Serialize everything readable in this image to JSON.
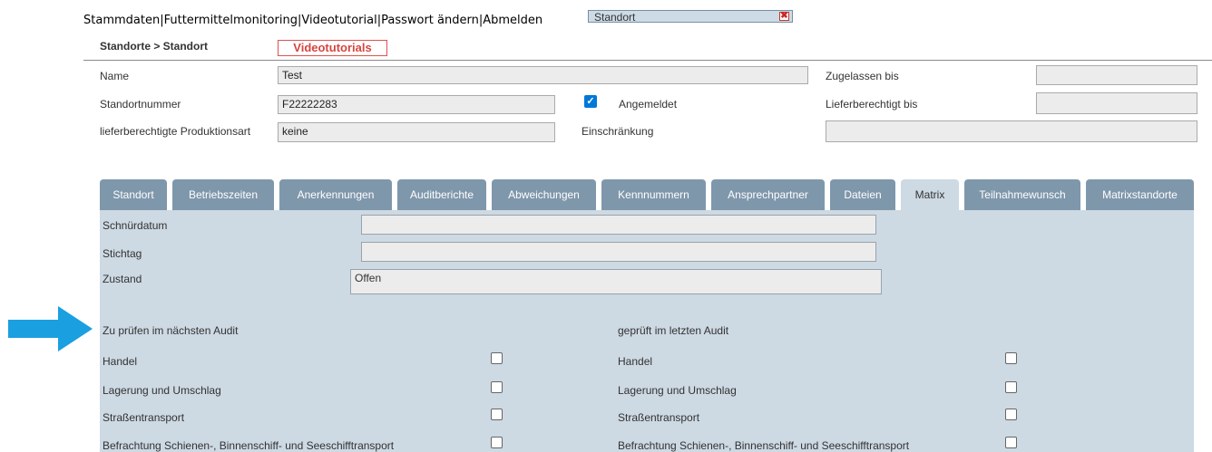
{
  "nav": {
    "items": [
      "Stammdaten",
      "Futtermittelmonitoring",
      "Videotutorial",
      "Passwort ändern",
      "Abmelden"
    ],
    "separator": "|"
  },
  "location_selector": {
    "value": "Standort",
    "close_glyph": "✖"
  },
  "breadcrumb": "Standorte > Standort",
  "video_button": "Videotutorials",
  "form": {
    "name_label": "Name",
    "name_value": "Test",
    "zugelassen_label": "Zugelassen bis",
    "zugelassen_value": "",
    "standortnummer_label": "Standortnummer",
    "standortnummer_value": "F22222283",
    "angemeldet_checked": true,
    "angemeldet_label": "Angemeldet",
    "lieferberechtigt_label": "Lieferberechtigt bis",
    "lieferberechtigt_value": "",
    "produktionsart_label": "lieferberechtigte Produktionsart",
    "produktionsart_value": "keine",
    "einschraenkung_label": "Einschränkung",
    "einschraenkung_value": ""
  },
  "tabs": [
    "Standort",
    "Betriebszeiten",
    "Anerkennungen",
    "Auditberichte",
    "Abweichungen",
    "Kennnummern",
    "Ansprechpartner",
    "Dateien",
    "Matrix",
    "Teilnahmewunsch",
    "Matrixstandorte"
  ],
  "active_tab": "Matrix",
  "matrix": {
    "schnuerdatum_label": "Schnürdatum",
    "schnuerdatum_value": "",
    "stichtag_label": "Stichtag",
    "stichtag_value": "",
    "zustand_label": "Zustand",
    "zustand_value": "Offen",
    "next_audit_heading": "Zu prüfen im nächsten Audit",
    "last_audit_heading": "geprüft im letzten Audit",
    "rows": [
      {
        "label": "Handel",
        "next": false,
        "last": false
      },
      {
        "label": "Lagerung und Umschlag",
        "next": false,
        "last": false
      },
      {
        "label": "Straßentransport",
        "next": false,
        "last": false
      },
      {
        "label": "Befrachtung Schienen-, Binnenschiff- und Seeschifftransport",
        "next": false,
        "last": false
      }
    ]
  },
  "colors": {
    "tab": "#7f97ab",
    "panel": "#cdd9e3",
    "arrow": "#1a9fe0",
    "video_button": "#d64540"
  }
}
